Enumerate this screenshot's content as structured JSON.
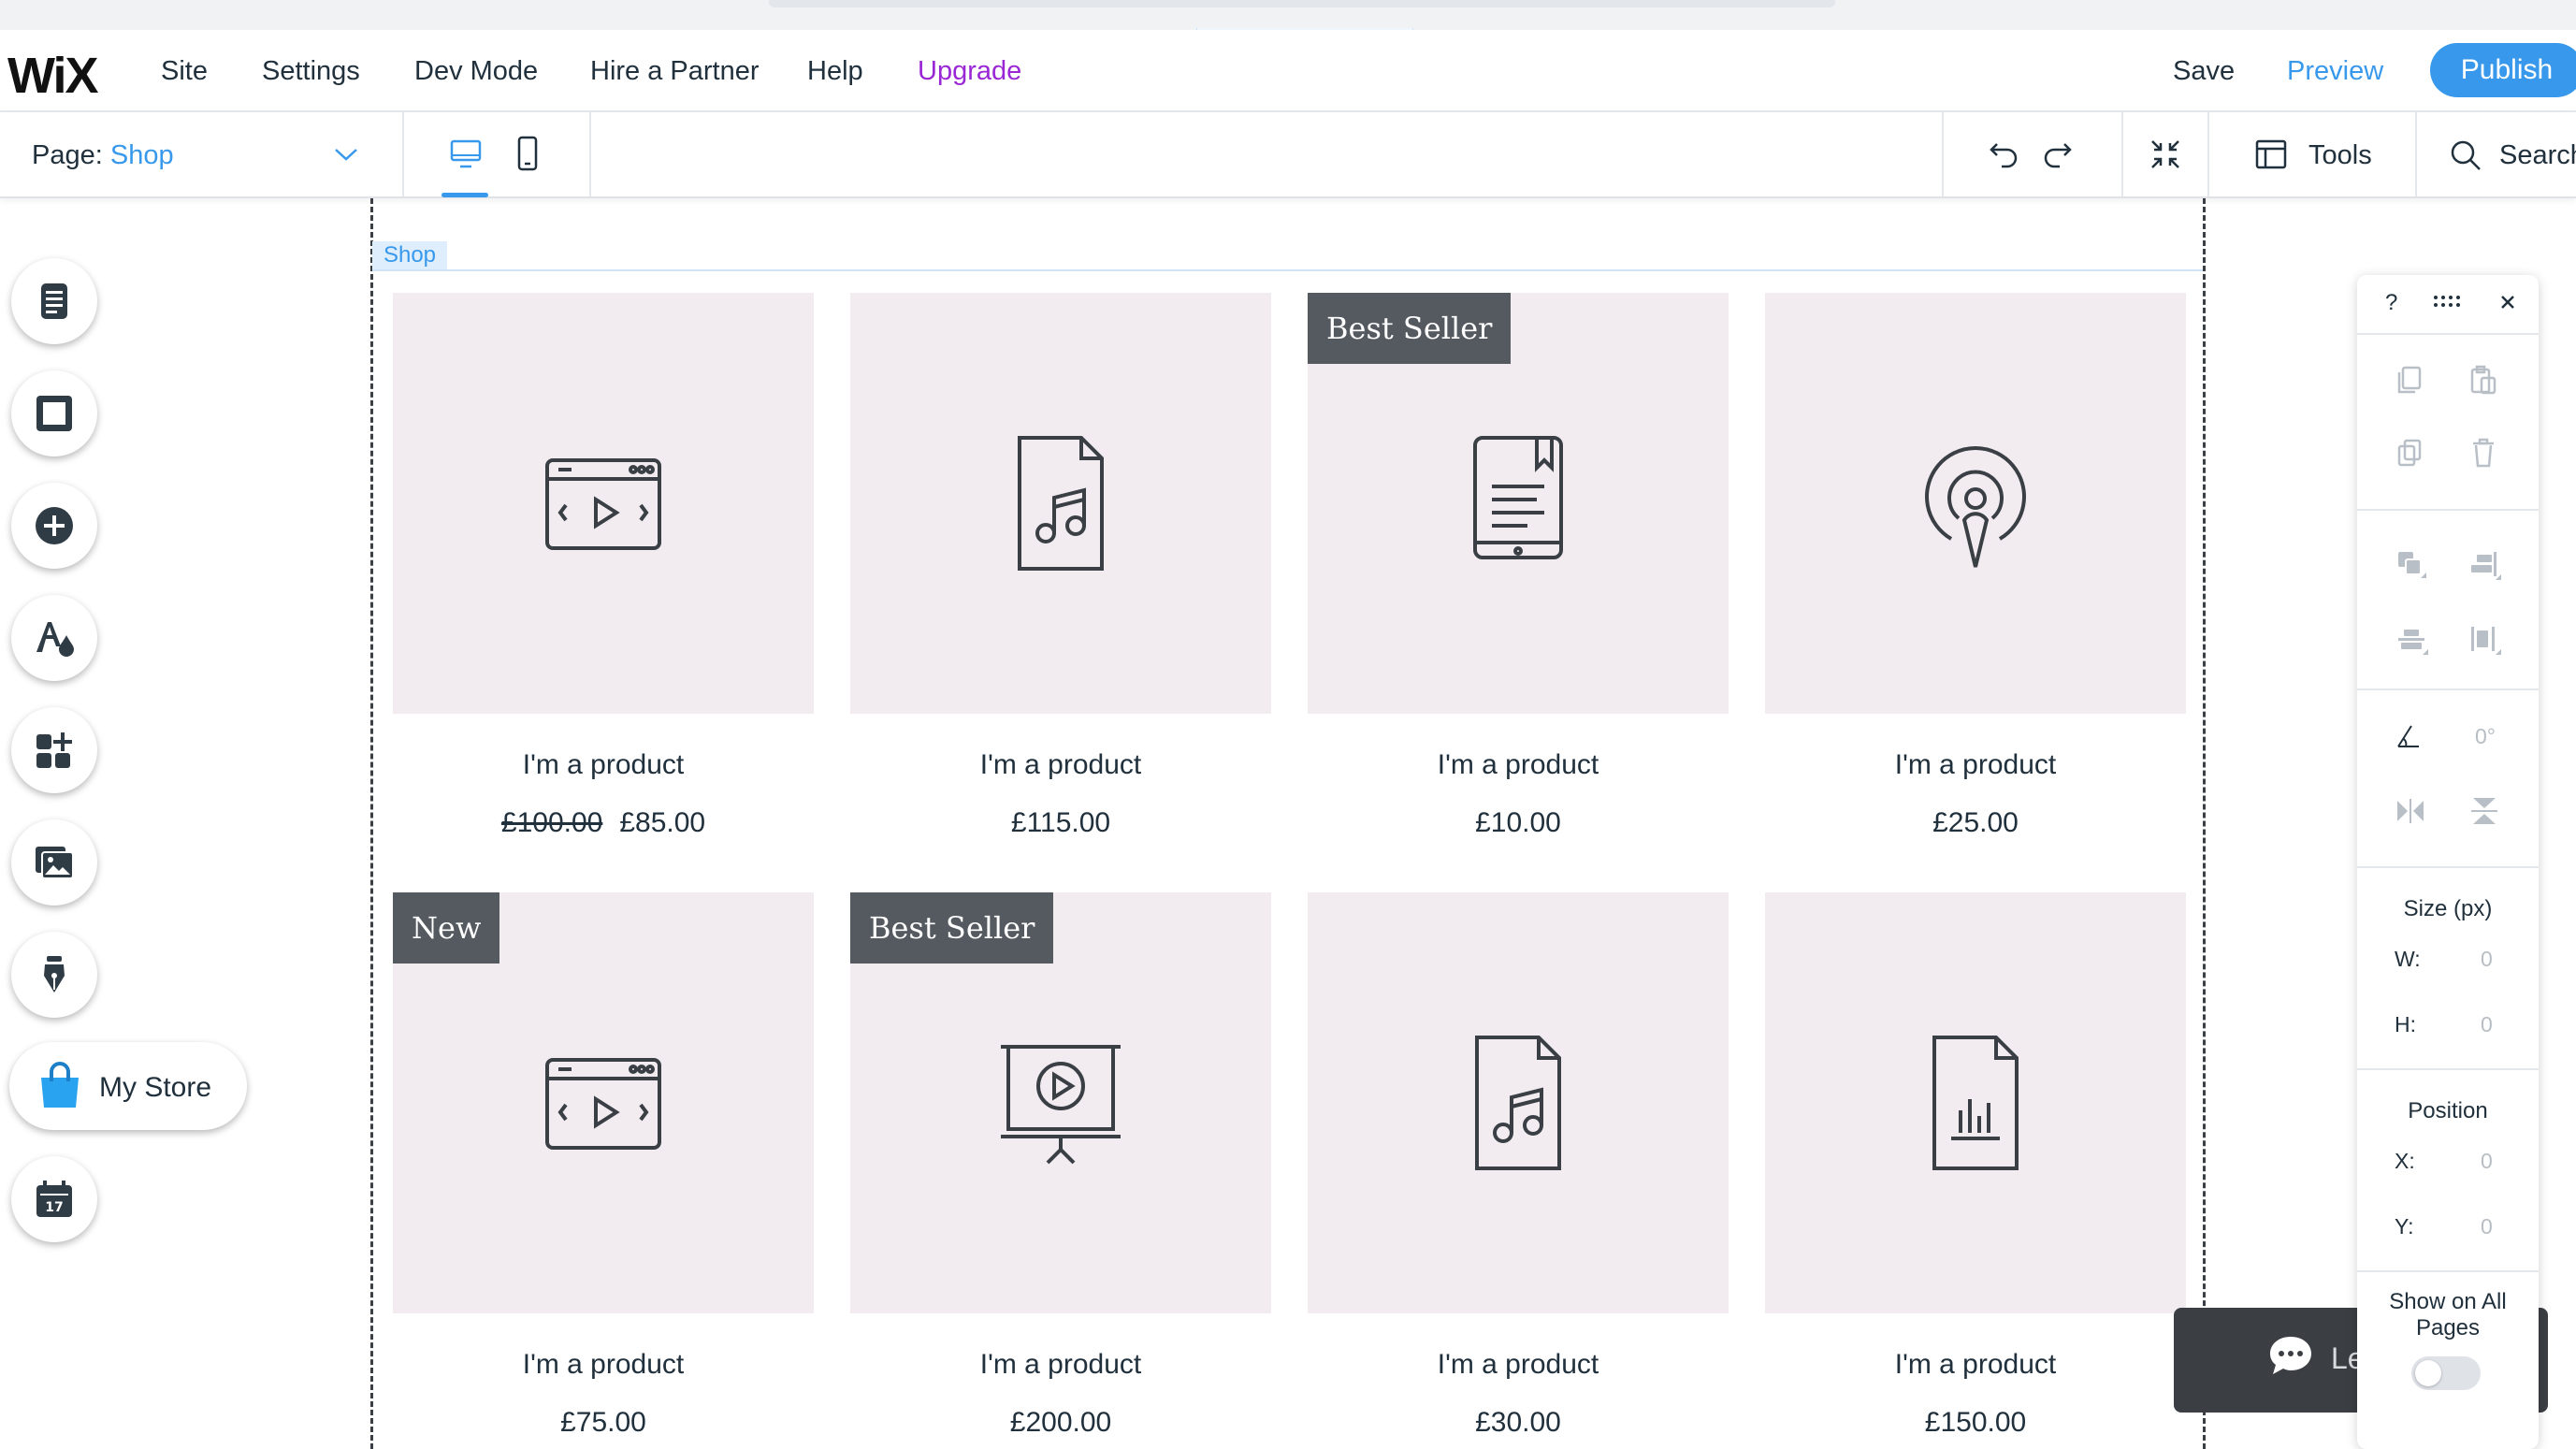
{
  "header": {
    "logo": "WiX",
    "menu": [
      "Site",
      "Settings",
      "Dev Mode",
      "Hire a Partner",
      "Help",
      "Upgrade"
    ],
    "save": "Save",
    "preview": "Preview",
    "publish": "Publish"
  },
  "toolbar": {
    "page_prefix": "Page:",
    "page_value": "Shop",
    "tools": "Tools",
    "search": "Search"
  },
  "canvas": {
    "section_tag": "Shop",
    "products": [
      {
        "name": "I'm a product",
        "old_price": "£100.00",
        "price": "£85.00",
        "badge": "",
        "icon": "video-player-icon"
      },
      {
        "name": "I'm a product",
        "old_price": "",
        "price": "£115.00",
        "badge": "",
        "icon": "music-file-icon"
      },
      {
        "name": "I'm a product",
        "old_price": "",
        "price": "£10.00",
        "badge": "Best Seller",
        "icon": "ebook-tablet-icon"
      },
      {
        "name": "I'm a product",
        "old_price": "",
        "price": "£25.00",
        "badge": "",
        "icon": "podcast-icon"
      },
      {
        "name": "I'm a product",
        "old_price": "",
        "price": "£75.00",
        "badge": "New",
        "icon": "video-player-icon"
      },
      {
        "name": "I'm a product",
        "old_price": "",
        "price": "£200.00",
        "badge": "Best Seller",
        "icon": "presentation-icon"
      },
      {
        "name": "I'm a product",
        "old_price": "",
        "price": "£30.00",
        "badge": "",
        "icon": "music-file-icon"
      },
      {
        "name": "I'm a product",
        "old_price": "",
        "price": "£150.00",
        "badge": "",
        "icon": "chart-file-icon"
      }
    ]
  },
  "left_rail": {
    "my_store": "My Store"
  },
  "chat": {
    "label": "Let's Chat!"
  },
  "panel": {
    "help": "?",
    "rotation": "0°",
    "size_title": "Size (px)",
    "w_label": "W:",
    "w_value": "0",
    "h_label": "H:",
    "h_value": "0",
    "position_title": "Position",
    "x_label": "X:",
    "x_value": "0",
    "y_label": "Y:",
    "y_value": "0",
    "show_all_pages": "Show on All Pages"
  },
  "colors": {
    "accent": "#3899ec",
    "upgrade": "#9a27d5",
    "product_bg": "#f2ecf0",
    "badge_bg": "#545a60"
  }
}
